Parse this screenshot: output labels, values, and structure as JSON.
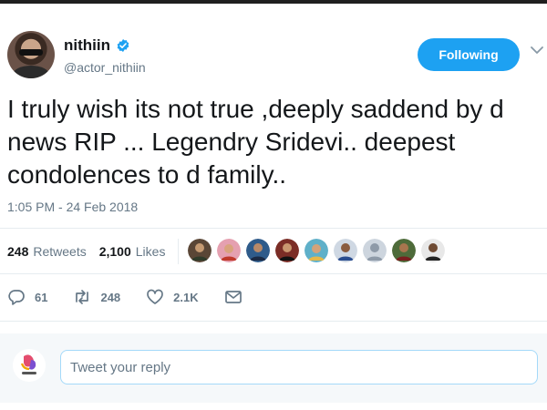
{
  "tweet": {
    "author": {
      "display_name": "nithiin",
      "handle": "@actor_nithiin",
      "verified": true
    },
    "follow_button_label": "Following",
    "text": "I truly wish its not true ,deeply saddend by d news RIP ... Legendry Sridevi.. deepest condolences to d family..",
    "timestamp": "1:05 PM - 24 Feb 2018",
    "stats": {
      "retweets_count": "248",
      "retweets_label": "Retweets",
      "likes_count": "2,100",
      "likes_label": "Likes"
    },
    "likers_avatar_count": 9,
    "actions": {
      "reply_count": "61",
      "retweet_count": "248",
      "like_count": "2.1K"
    }
  },
  "reply": {
    "placeholder": "Tweet your reply"
  },
  "colors": {
    "accent": "#1da1f2",
    "text_primary": "#14171a",
    "text_secondary": "#657786",
    "divider": "#e6ecf0"
  },
  "icons": {
    "verified": "verified-badge-icon",
    "caret": "chevron-down-icon",
    "reply": "reply-icon",
    "retweet": "retweet-icon",
    "like": "heart-icon",
    "dm": "envelope-icon"
  }
}
